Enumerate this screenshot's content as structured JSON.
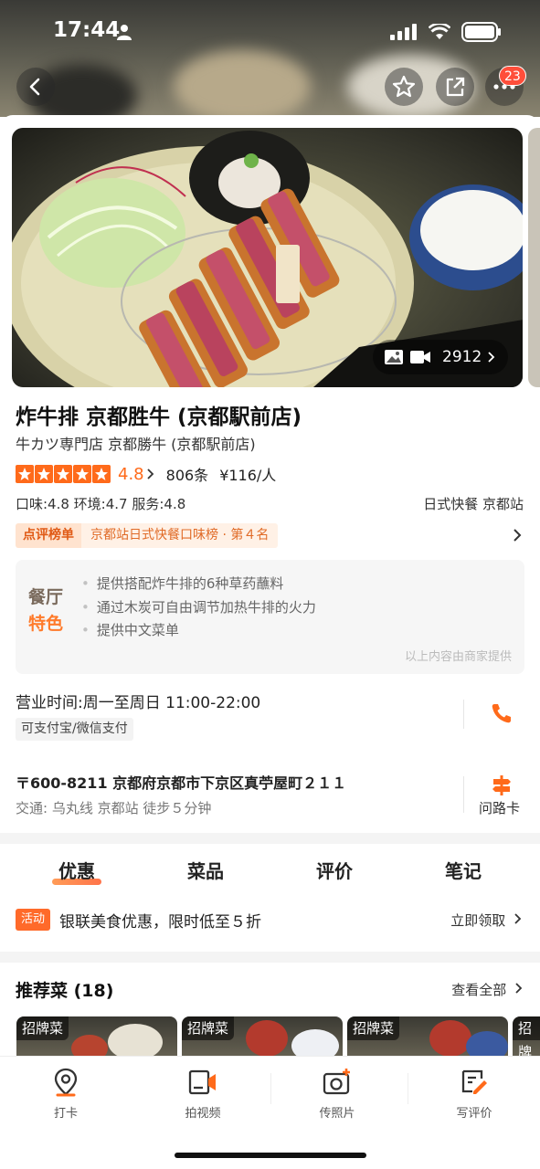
{
  "status": {
    "time": "17:44"
  },
  "header": {
    "notification_count": "23"
  },
  "photo": {
    "media_count": "2912"
  },
  "restaurant": {
    "name": "炸牛排 京都胜牛 (京都駅前店)",
    "original_name": "牛カツ専門店 京都勝牛 (京都駅前店)",
    "rating": 4.8,
    "rating_text": "4.8",
    "review_count": "806条",
    "avg_price": "¥116/人",
    "subscores": "口味:4.8  环境:4.7  服务:4.8",
    "cuisine_area": "日式快餐  京都站"
  },
  "ranking": {
    "label": "点评榜单",
    "text": "京都站日式快餐口味榜 · 第４名"
  },
  "features": {
    "tag_line1": "餐厅",
    "tag_line2": "特色",
    "items": [
      "提供搭配炸牛排的6种草药蘸料",
      "通过木炭可自由调节加热牛排的火力",
      "提供中文菜单"
    ],
    "note": "以上内容由商家提供"
  },
  "hours": {
    "text": "营业时间:周一至周日 11:00-22:00",
    "payment": "可支付宝/微信支付"
  },
  "address": {
    "text": "〒600-8211 京都府京都市下京区真苧屋町２１１",
    "transit": "交通: 乌丸线 京都站 徒步５分钟",
    "route_label": "问路卡"
  },
  "tabs": [
    "优惠",
    "菜品",
    "评价",
    "笔记"
  ],
  "promo": {
    "tag": "活动",
    "text": "银联美食优惠，限时低至５折",
    "link": "立即领取"
  },
  "recommended": {
    "title": "推荐菜 (18)",
    "link": "查看全部",
    "dish_tag": "招牌菜",
    "dish_tags": [
      "招牌菜",
      "招牌菜",
      "招牌菜",
      "招牌"
    ]
  },
  "bottom_bar": {
    "items": [
      "打卡",
      "拍视频",
      "传照片",
      "写评价"
    ]
  },
  "colors": {
    "accent": "#ff6a1a",
    "badge": "#ff4e3a"
  }
}
